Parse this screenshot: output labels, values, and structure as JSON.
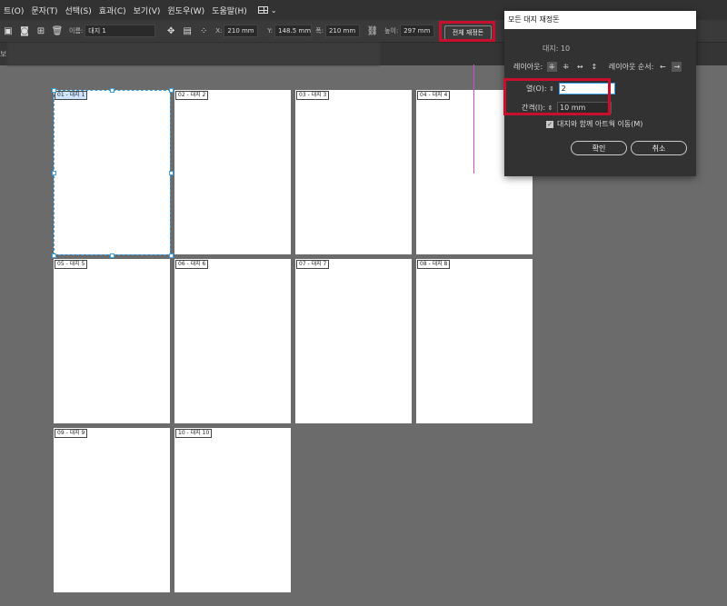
{
  "menubar": {
    "items": [
      "트(O)",
      "문자(T)",
      "선택(S)",
      "효과(C)",
      "보기(V)",
      "윈도우(W)",
      "도움말(H)"
    ]
  },
  "control_bar": {
    "name_label": "이름:",
    "name_value": "대지 1",
    "x_label": "X:",
    "x_value": "210 mm",
    "y_label": "Y:",
    "y_value": "148.5 mm",
    "width_label": "폭:",
    "width_value": "210 mm",
    "height_label": "높이:",
    "height_value": "297 mm",
    "rearrange_button": "전체 재정돈"
  },
  "tab": {
    "label": "보"
  },
  "artboards": [
    "01 - 대지 1",
    "02 - 대지 2",
    "03 - 대지 3",
    "04 - 대지 4",
    "05 - 대지 5",
    "06 - 대지 6",
    "07 - 대지 7",
    "08 - 대지 8",
    "09 - 대지 9",
    "10 - 대지 10"
  ],
  "dialog": {
    "title": "모든 대지 재정돈",
    "count": "대지: 10",
    "layout_label": "레이아웃:",
    "order_label": "레이아웃 순서:",
    "columns_label": "열(O):",
    "columns_value": "2",
    "spacing_label": "간격(I):",
    "spacing_value": "10 mm",
    "move_artwork_label": "대지와 함께 아트웍 이동(M)",
    "move_artwork_checked": true,
    "ok_button": "확인",
    "cancel_button": "취소"
  },
  "colors": {
    "highlight": "#c8102e",
    "selection": "#3aa0e8",
    "guide": "#d24bd2"
  }
}
